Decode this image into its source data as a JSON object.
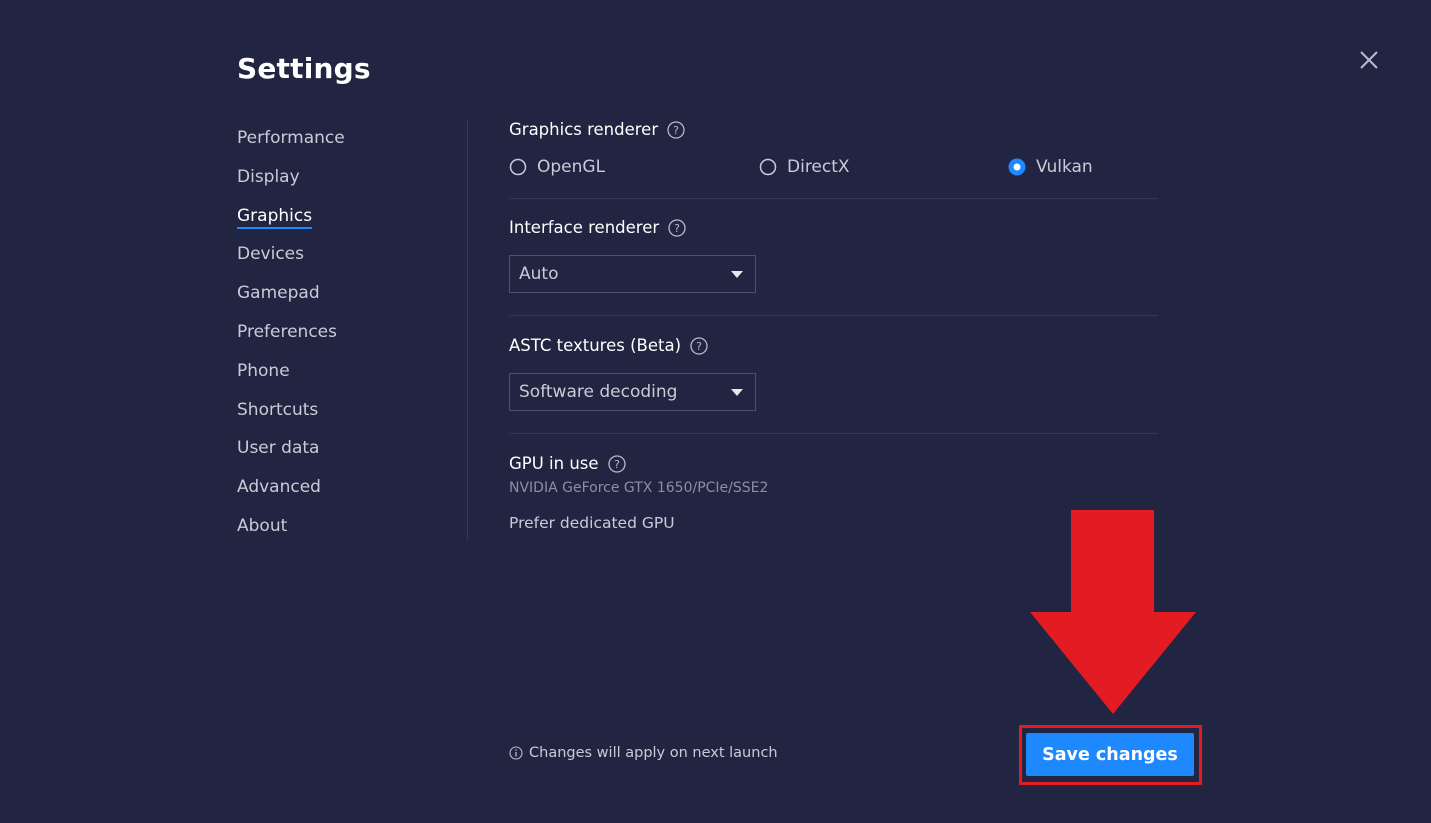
{
  "window": {
    "title": "Settings"
  },
  "sidebar": {
    "active": "Graphics",
    "items": [
      {
        "label": "Performance"
      },
      {
        "label": "Display"
      },
      {
        "label": "Graphics"
      },
      {
        "label": "Devices"
      },
      {
        "label": "Gamepad"
      },
      {
        "label": "Preferences"
      },
      {
        "label": "Phone"
      },
      {
        "label": "Shortcuts"
      },
      {
        "label": "User data"
      },
      {
        "label": "Advanced"
      },
      {
        "label": "About"
      }
    ]
  },
  "graphics_renderer": {
    "label": "Graphics renderer",
    "selected": "Vulkan",
    "options": [
      {
        "label": "OpenGL",
        "checked": false
      },
      {
        "label": "DirectX",
        "checked": false
      },
      {
        "label": "Vulkan",
        "checked": true
      }
    ]
  },
  "interface_renderer": {
    "label": "Interface renderer",
    "value": "Auto"
  },
  "astc_textures": {
    "label": "ASTC textures (Beta)",
    "value": "Software decoding"
  },
  "gpu": {
    "label": "GPU in use",
    "name": "NVIDIA GeForce GTX 1650/PCIe/SSE2",
    "prefer_dedicated": "Prefer dedicated GPU"
  },
  "footer": {
    "note": "Changes will apply on next launch",
    "save_label": "Save changes"
  },
  "colors": {
    "background": "#212541",
    "accent": "#1e88ff",
    "highlight_red": "#e31b23"
  },
  "icons": {
    "close": "close-icon",
    "help": "help-circle-icon",
    "info": "info-icon",
    "annotation": "red-down-arrow"
  }
}
